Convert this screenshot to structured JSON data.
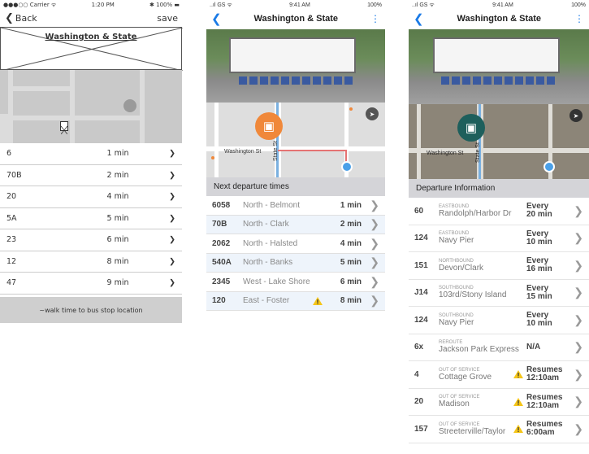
{
  "s1": {
    "status_left": "●●●○○ Carrier ᯤ",
    "status_time": "1:20 PM",
    "status_right": "✱ 100% ▬",
    "back_label": "Back",
    "save_label": "save",
    "title": "Washington & State",
    "rows": [
      {
        "route": "6",
        "time": "1 min"
      },
      {
        "route": "70B",
        "time": "2 min"
      },
      {
        "route": "20",
        "time": "4 min"
      },
      {
        "route": "5A",
        "time": "5 min"
      },
      {
        "route": "23",
        "time": "6 min"
      },
      {
        "route": "12",
        "time": "8 min"
      },
      {
        "route": "47",
        "time": "9 min"
      }
    ],
    "footer": "~walk time to bus stop location"
  },
  "s2": {
    "status_left": "..ıl GS ᯤ",
    "status_time": "9:41 AM",
    "status_right": "100%",
    "title": "Washington & State",
    "street": "Washington St",
    "street2": "State St",
    "section": "Next departure times",
    "rows": [
      {
        "route": "6058",
        "dest": "North - Belmont",
        "time": "1 min",
        "warn": false
      },
      {
        "route": "70B",
        "dest": "North - Clark",
        "time": "2 min",
        "warn": false
      },
      {
        "route": "2062",
        "dest": "North - Halsted",
        "time": "4 min",
        "warn": false
      },
      {
        "route": "540A",
        "dest": "North - Banks",
        "time": "5 min",
        "warn": false
      },
      {
        "route": "2345",
        "dest": "West - Lake Shore",
        "time": "6 min",
        "warn": false
      },
      {
        "route": "120",
        "dest": "East - Foster",
        "time": "8 min",
        "warn": true
      }
    ]
  },
  "s3": {
    "status_left": "..ıl GS ᯤ",
    "status_time": "9:41 AM",
    "status_right": "100%",
    "title": "Washington & State",
    "street": "Washington St",
    "street2": "State St",
    "section": "Departure Information",
    "rows": [
      {
        "route": "60",
        "dir": "EASTBOUND",
        "dest": "Randolph/Harbor Dr",
        "t1": "Every",
        "t2": "20 min",
        "warn": false
      },
      {
        "route": "124",
        "dir": "EASTBOUND",
        "dest": "Navy Pier",
        "t1": "Every",
        "t2": "10 min",
        "warn": false
      },
      {
        "route": "151",
        "dir": "NORTHBOUND",
        "dest": "Devon/Clark",
        "t1": "Every",
        "t2": "16 min",
        "warn": false
      },
      {
        "route": "J14",
        "dir": "SOUTHBOUND",
        "dest": "103rd/Stony Island",
        "t1": "Every",
        "t2": "15 min",
        "warn": false
      },
      {
        "route": "124",
        "dir": "SOUTHBOUND",
        "dest": "Navy Pier",
        "t1": "Every",
        "t2": "10 min",
        "warn": false
      },
      {
        "route": "6x",
        "dir": "REROUTE",
        "dest": "Jackson Park Express",
        "t1": "N/A",
        "t2": "",
        "warn": false
      },
      {
        "route": "4",
        "dir": "OUT OF SERVICE",
        "dest": "Cottage Grove",
        "t1": "Resumes",
        "t2": "12:10am",
        "warn": true
      },
      {
        "route": "20",
        "dir": "OUT OF SERVICE",
        "dest": "Madison",
        "t1": "Resumes",
        "t2": "12:10am",
        "warn": true
      },
      {
        "route": "157",
        "dir": "OUT OF SERVICE",
        "dest": "Streeterville/Taylor",
        "t1": "Resumes",
        "t2": "6:00am",
        "warn": true
      }
    ]
  },
  "colors": {
    "accent": "#1a7ae6",
    "pin_orange": "#f0883a",
    "pin_teal": "#1e5f5c",
    "warn": "#f5c518"
  }
}
